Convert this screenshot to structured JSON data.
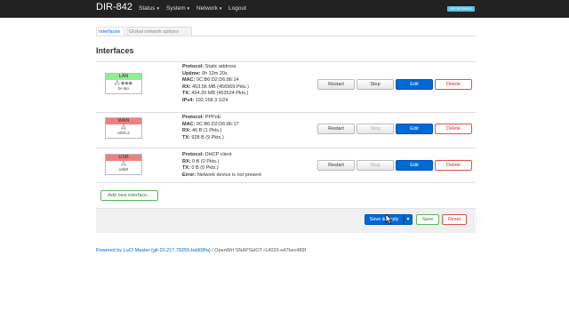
{
  "navbar": {
    "brand": "DIR-842",
    "items": [
      {
        "label": "Status"
      },
      {
        "label": "System"
      },
      {
        "label": "Network"
      },
      {
        "label": "Logout"
      }
    ],
    "badge": "REFRESHING"
  },
  "tabs": [
    {
      "label": "Interfaces"
    },
    {
      "label": "Global network options"
    }
  ],
  "section_title": "Interfaces",
  "interfaces": [
    {
      "name": "LAN",
      "color": "#90ee90",
      "device": "br-lan",
      "fields": [
        {
          "k": "Protocol:",
          "v": "Static address"
        },
        {
          "k": "Uptime:",
          "v": "0h 12m 20s"
        },
        {
          "k": "MAC:",
          "v": "0C:B6:D2:D6:86:14"
        },
        {
          "k": "RX:",
          "v": "453.56 MB (456969 Pkts.)"
        },
        {
          "k": "TX:",
          "v": "454.20 MB (453524 Pkts.)"
        },
        {
          "k": "IPv4:",
          "v": "192.168.3.1/24"
        }
      ]
    },
    {
      "name": "WAN",
      "color": "#f08080",
      "device": "eth0.2",
      "fields": [
        {
          "k": "Protocol:",
          "v": "PPPoE"
        },
        {
          "k": "MAC:",
          "v": "0C:B6:D2:D6:86:17"
        },
        {
          "k": "RX:",
          "v": "46 B (1 Pkts.)"
        },
        {
          "k": "TX:",
          "v": "928 B (9 Pkts.)"
        }
      ]
    },
    {
      "name": "USB",
      "color": "#f08080",
      "device": "usb0",
      "fields": [
        {
          "k": "Protocol:",
          "v": "DHCP client"
        },
        {
          "k": "RX:",
          "v": "0 B (0 Pkts.)"
        },
        {
          "k": "TX:",
          "v": "0 B (0 Pkts.)"
        },
        {
          "k": "Error:",
          "v": "Network device is not present"
        }
      ]
    }
  ],
  "buttons": {
    "restart": "Restart",
    "stop": "Stop",
    "edit": "Edit",
    "delete": "Delete",
    "add": "Add new interface...",
    "save_apply": "Save & Apply",
    "save": "Save",
    "reset": "Reset"
  },
  "footer": {
    "luci_link": "Powered by LuCI Master (git-20.217.79255-ba908fa)",
    "rest": " / OpenWrt SNAPSHOT r14032-e47bec489f"
  }
}
